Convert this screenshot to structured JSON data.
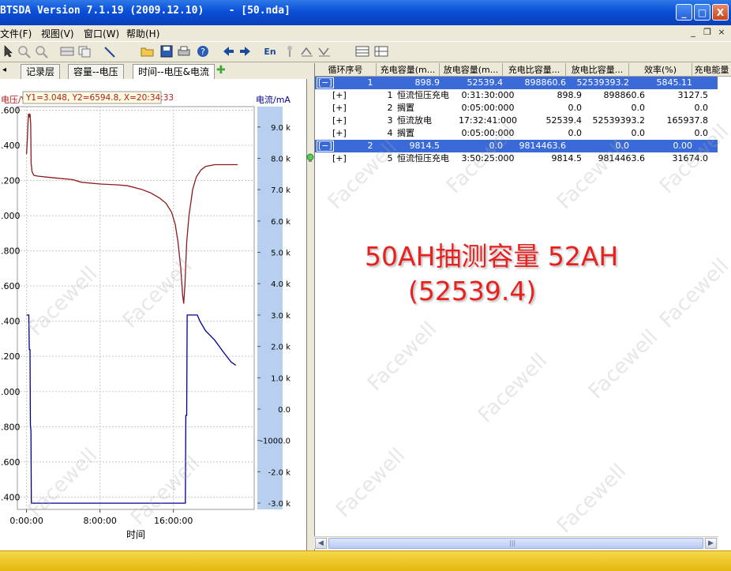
{
  "window": {
    "title": "BTSDA Version 7.1.19 (2009.12.10)    - [50.nda]",
    "min_glyph": "_",
    "max_glyph": "□",
    "close_glyph": "X"
  },
  "menu": {
    "items": [
      "文件(F)",
      "视图(V)",
      "窗口(W)",
      "帮助(H)"
    ],
    "mdi_min": "_",
    "mdi_restore": "❐",
    "mdi_close": "×"
  },
  "toolbar": {
    "icons": [
      "pointer-icon",
      "zoom-in-icon",
      "zoom-out-icon",
      "grid-icon",
      "copy-icon",
      "line-tool-icon",
      "open-folder-icon",
      "save-icon",
      "print-icon",
      "help-icon",
      "arrow-left-icon",
      "arrow-right-icon",
      "english-icon",
      "pin-icon",
      "charge-icon",
      "discharge-icon",
      "table-view-icon",
      "table-edit-icon"
    ],
    "english_label": "En"
  },
  "tabs": {
    "scroll_glyph": "◂",
    "items": [
      "记录层",
      "容量--电压",
      "时间--电压&电流"
    ],
    "active_index": 2,
    "add_glyph": "✚"
  },
  "chart_data": {
    "type": "line",
    "left_axis_label": "电压/V",
    "right_axis_label": "电流/mA",
    "xlabel": "时间",
    "readout": "Y1=3.048, Y2=6594.8, X=20:34:33",
    "x_range_hours": [
      -1.0,
      24.8
    ],
    "x_ticks": [
      {
        "h": 0,
        "label": "0:00:00"
      },
      {
        "h": 8,
        "label": "8:00:00"
      },
      {
        "h": 16,
        "label": "16:00:00"
      }
    ],
    "voltage_range": [
      1.33,
      3.62
    ],
    "voltage_ticks": [
      {
        "v": 3.6,
        "label": ".600"
      },
      {
        "v": 3.4,
        "label": ".400"
      },
      {
        "v": 3.2,
        "label": ".200"
      },
      {
        "v": 3.0,
        "label": ".000"
      },
      {
        "v": 2.8,
        "label": ".800"
      },
      {
        "v": 2.6,
        "label": ".600"
      },
      {
        "v": 2.4,
        "label": ".400"
      },
      {
        "v": 2.2,
        "label": ".200"
      },
      {
        "v": 2.0,
        "label": ".000"
      },
      {
        "v": 1.8,
        "label": ".800"
      },
      {
        "v": 1.6,
        "label": ".600"
      },
      {
        "v": 1.4,
        "label": ".400"
      }
    ],
    "current_range": [
      -3200,
      9650
    ],
    "current_ticks": [
      {
        "v": 9000,
        "label": "9.0 k"
      },
      {
        "v": 8000,
        "label": "8.0 k"
      },
      {
        "v": 7000,
        "label": "7.0 k"
      },
      {
        "v": 6000,
        "label": "6.0 k"
      },
      {
        "v": 5000,
        "label": "5.0 k"
      },
      {
        "v": 4000,
        "label": "4.0 k"
      },
      {
        "v": 3000,
        "label": "3.0 k"
      },
      {
        "v": 2000,
        "label": "2.0 k"
      },
      {
        "v": 1000,
        "label": "1.0 k"
      },
      {
        "v": 0,
        "label": "0.0"
      },
      {
        "v": -1000,
        "label": "-1000.0"
      },
      {
        "v": -2000,
        "label": "-2.0 k"
      },
      {
        "v": -3000,
        "label": "-3.0 k"
      }
    ],
    "series": [
      {
        "name": "电压",
        "color": "#8b1a1a",
        "points": [
          [
            0,
            3.35
          ],
          [
            0.05,
            3.4
          ],
          [
            0.1,
            3.45
          ],
          [
            0.15,
            3.52
          ],
          [
            0.22,
            3.58
          ],
          [
            0.3,
            3.56
          ],
          [
            0.38,
            3.58
          ],
          [
            0.45,
            3.52
          ],
          [
            0.5,
            3.3
          ],
          [
            0.6,
            3.25
          ],
          [
            0.8,
            3.23
          ],
          [
            1.2,
            3.225
          ],
          [
            3,
            3.215
          ],
          [
            5,
            3.205
          ],
          [
            6,
            3.19
          ],
          [
            8,
            3.18
          ],
          [
            10,
            3.175
          ],
          [
            11,
            3.17
          ],
          [
            12.5,
            3.15
          ],
          [
            13.5,
            3.13
          ],
          [
            14.5,
            3.1
          ],
          [
            15.2,
            3.07
          ],
          [
            15.8,
            3.02
          ],
          [
            16.2,
            2.95
          ],
          [
            16.5,
            2.85
          ],
          [
            16.8,
            2.7
          ],
          [
            17.0,
            2.55
          ],
          [
            17.12,
            2.5
          ],
          [
            17.25,
            2.6
          ],
          [
            17.45,
            2.85
          ],
          [
            17.7,
            3.0
          ],
          [
            18.1,
            3.15
          ],
          [
            18.5,
            3.22
          ],
          [
            19,
            3.26
          ],
          [
            19.5,
            3.28
          ],
          [
            20,
            3.285
          ],
          [
            20.5,
            3.29
          ],
          [
            22,
            3.29
          ],
          [
            23,
            3.29
          ]
        ]
      },
      {
        "name": "电流",
        "color": "#00008b",
        "points": [
          [
            0,
            3000
          ],
          [
            0.25,
            3000
          ],
          [
            0.3,
            1900
          ],
          [
            0.38,
            1900
          ],
          [
            0.42,
            -500
          ],
          [
            0.48,
            -700
          ],
          [
            0.52,
            -3000
          ],
          [
            17.3,
            -3000
          ],
          [
            17.35,
            -200
          ],
          [
            17.45,
            -200
          ],
          [
            17.5,
            3000
          ],
          [
            18.6,
            3000
          ],
          [
            18.9,
            2800
          ],
          [
            19.5,
            2500
          ],
          [
            20.5,
            2200
          ],
          [
            21.5,
            1800
          ],
          [
            22.3,
            1500
          ],
          [
            22.8,
            1400
          ]
        ]
      }
    ]
  },
  "table": {
    "headers": [
      "循环序号",
      "充电容量(m...",
      "放电容量(m...",
      "充电比容量...",
      "放电比容量...",
      "效率(%)",
      "充电能量"
    ],
    "rows": [
      {
        "level": 0,
        "expand": "[−]",
        "id": "1",
        "c1": "898.9",
        "c2": "52539.4",
        "c3": "898860.6",
        "c4": "52539393.2",
        "c5": "5845.11"
      },
      {
        "level": 1,
        "expand": "[+]",
        "id": "1",
        "type": "恒流恒压充电",
        "time": "0:31:30:000",
        "c1": "898.9",
        "c2": "898860.6",
        "c3": "3127.5"
      },
      {
        "level": 1,
        "expand": "[+]",
        "id": "2",
        "type": "搁置",
        "time": "0:05:00:000",
        "c1": "0.0",
        "c2": "0.0",
        "c3": "0.0"
      },
      {
        "level": 1,
        "expand": "[+]",
        "id": "3",
        "type": "恒流放电",
        "time": "17:32:41:000",
        "c1": "52539.4",
        "c2": "52539393.2",
        "c3": "165937.8"
      },
      {
        "level": 1,
        "expand": "[+]",
        "id": "4",
        "type": "搁置",
        "time": "0:05:00:000",
        "c1": "0.0",
        "c2": "0.0",
        "c3": "0.0"
      },
      {
        "level": 0,
        "expand": "[−]",
        "id": "2",
        "c1": "9814.5",
        "c2": "0.0",
        "c3": "9814463.6",
        "c4": "0.0",
        "c5": "0.00"
      },
      {
        "level": 1,
        "expand": "[+]",
        "id": "5",
        "type": "恒流恒压充电",
        "time": "3:50:25:000",
        "c1": "9814.5",
        "c2": "9814463.6",
        "c3": "31674.0"
      }
    ]
  },
  "annotation": {
    "line1": "50AH抽测容量 52AH",
    "line2": "(52539.4)"
  },
  "watermark": "Facewell",
  "scrollbar": {
    "left_glyph": "◀",
    "right_glyph": "▶",
    "grip": "|||"
  }
}
